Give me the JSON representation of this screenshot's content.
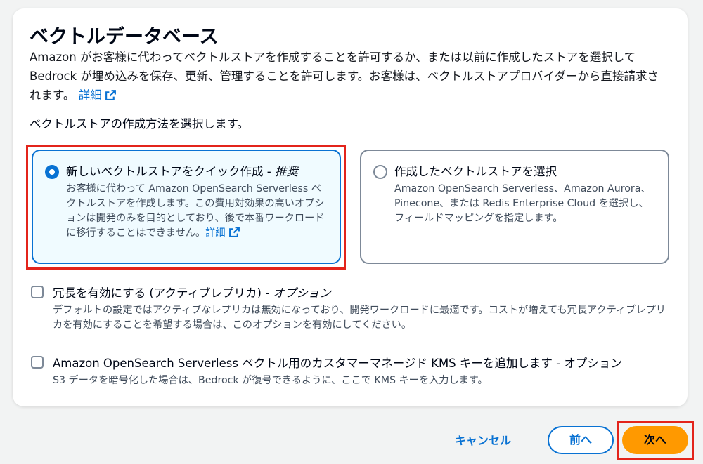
{
  "section": {
    "title": "ベクトルデータベース",
    "description": "Amazon がお客様に代わってベクトルストアを作成することを許可するか、または以前に作成したストアを選択して Bedrock が埋め込みを保存、更新、管理することを許可します。お客様は、ベクトルストアプロバイダーから直接請求されます。",
    "learn_more": "詳細",
    "question": "ベクトルストアの作成方法を選択します。"
  },
  "options": [
    {
      "title": "新しいベクトルストアをクイック作成 - ",
      "title_emphasis": "推奨",
      "description": "お客様に代わって Amazon OpenSearch Serverless ベクトルストアを作成します。この費用対効果の高いオプションは開発のみを目的としており、後で本番ワークロードに移行することはできません。",
      "learn_more": "詳細",
      "selected": true
    },
    {
      "title": "作成したベクトルストアを選択",
      "description": "Amazon OpenSearch Serverless、Amazon Aurora、Pinecone、または Redis Enterprise Cloud を選択し、フィールドマッピングを指定します。",
      "selected": false
    }
  ],
  "checkboxes": [
    {
      "label": "冗長を有効にする (アクティブレプリカ) - ",
      "label_emphasis": "オプション",
      "description": "デフォルトの設定ではアクティブなレプリカは無効になっており、開発ワークロードに最適です。コストが増えても冗長アクティブレプリカを有効にすることを希望する場合は、このオプションを有効にしてください。",
      "checked": false
    },
    {
      "label": "Amazon OpenSearch Serverless ベクトル用のカスタマーマネージド KMS キーを追加します - オプション",
      "description": "S3 データを暗号化した場合は、Bedrock が復号できるように、ここで KMS キーを入力します。",
      "checked": false
    }
  ],
  "footer": {
    "cancel": "キャンセル",
    "previous": "前へ",
    "next": "次へ"
  },
  "colors": {
    "link": "#0972d3",
    "primary_button": "#ff9900",
    "highlight": "#e3241b"
  }
}
